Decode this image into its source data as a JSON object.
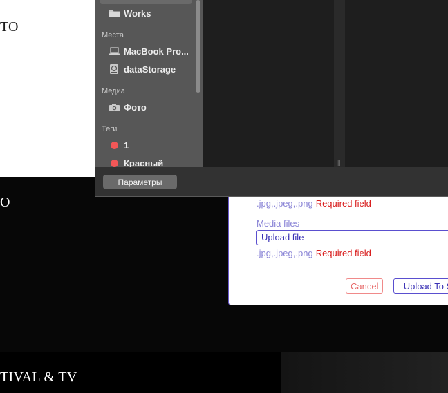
{
  "background_page": {
    "text_top": "ТО",
    "text_middle": "О",
    "text_bottom": "TIVAL & TV"
  },
  "upload_modal": {
    "hint_1": {
      "extensions": ".jpg,.jpeg,.png",
      "required": "Required field"
    },
    "media_label": "Media files",
    "file_input_value": "Upload file",
    "hint_2": {
      "extensions": ".jpg,.jpeg,.png",
      "required": "Required field"
    },
    "cancel_label": "Cancel",
    "upload_label": "Upload To S"
  },
  "file_dialog": {
    "sidebar": {
      "favorites": [
        {
          "label": "Works",
          "icon": "folder-icon"
        }
      ],
      "places_header": "Места",
      "places": [
        {
          "label": "MacBook Pro...",
          "icon": "laptop-icon"
        },
        {
          "label": "dataStorage",
          "icon": "drive-icon"
        }
      ],
      "media_header": "Медиа",
      "media": [
        {
          "label": "Фото",
          "icon": "camera-icon"
        }
      ],
      "tags_header": "Теги",
      "tags": [
        {
          "label": "1",
          "color": "#f25757"
        },
        {
          "label": "Красный",
          "color": "#f25757"
        }
      ]
    },
    "options_button": "Параметры"
  }
}
